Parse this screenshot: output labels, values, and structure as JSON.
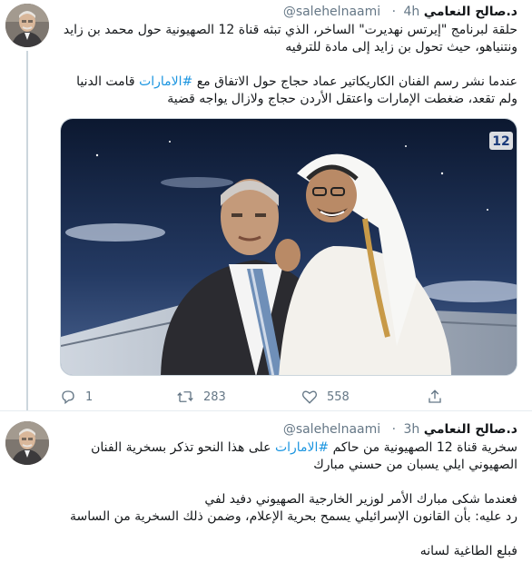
{
  "tweets": [
    {
      "author": {
        "name": "د.صالح النعامي",
        "handle": "@salehelnaami",
        "avatar_icon": "profile-avatar"
      },
      "time": "4h",
      "paragraphs": [
        "حلقة لبرنامج \"إيرتس نهديرت\" الساخر، الذي تبثه قناة 12 الصهيونية حول محمد بن زايد ونتنياهو، حيث تحول بن زايد إلى مادة للترفيه"
      ],
      "p2_before": "عندما نشر رسم الفنان الكاريكاتير عماد حجاج حول الاتفاق مع ",
      "p2_hashtag": "#الامارات",
      "p2_after": " قامت الدنيا ولم تقعد، ضغطت الإمارات واعتقل الأردن حجاج ولازال يواجه قضية",
      "media": {
        "channel_badge": "12",
        "alt_icon": "tv-show-still"
      },
      "stats": {
        "replies": "1",
        "retweets": "283",
        "likes": "558"
      }
    },
    {
      "author": {
        "name": "د.صالح النعامي",
        "handle": "@salehelnaami",
        "avatar_icon": "profile-avatar"
      },
      "time": "3h",
      "p1_before": "سخرية قناة 12 الصهيونية من حاكم ",
      "p1_hashtag": "#الامارات",
      "p1_after": " على هذا النحو تذكر بسخرية الفنان الصهيوني ايلي يسبان من حسني مبارك",
      "p2": "فعندما شكى مبارك الأمر لوزير الخارجية الصهيوني دفيد لفي\nرد عليه: بأن القانون الإسرائيلي يسمح بحرية الإعلام، وضمن ذلك السخرية من الساسة",
      "p3": "فبلع الطاغية لسانه"
    }
  ],
  "colors": {
    "accent": "#1b95e0",
    "muted": "#657786",
    "text": "#14171a",
    "divider": "#e6ecf0"
  }
}
